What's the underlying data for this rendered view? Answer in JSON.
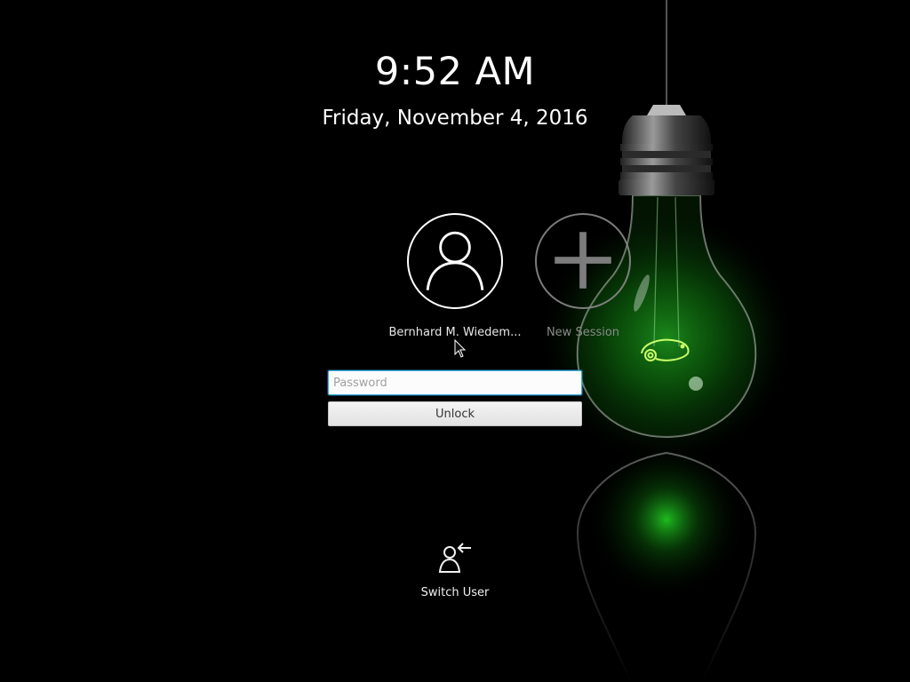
{
  "lockscreen": {
    "time": "9:52 AM",
    "date": "Friday, November 4, 2016"
  },
  "users": {
    "current": {
      "name": "Bernhard M. Wiedem...",
      "avatar_icon": "user-icon"
    },
    "new_session": {
      "label": "New Session",
      "avatar_icon": "plus-icon"
    }
  },
  "login": {
    "password_placeholder": "Password",
    "password_value": "",
    "unlock_label": "Unlock"
  },
  "actions": {
    "switch_user_label": "Switch User",
    "switch_user_icon": "switch-user-icon"
  },
  "colors": {
    "background": "#000000",
    "focus_accent": "#3daee9",
    "bulb_glow": "#1fb81f"
  }
}
